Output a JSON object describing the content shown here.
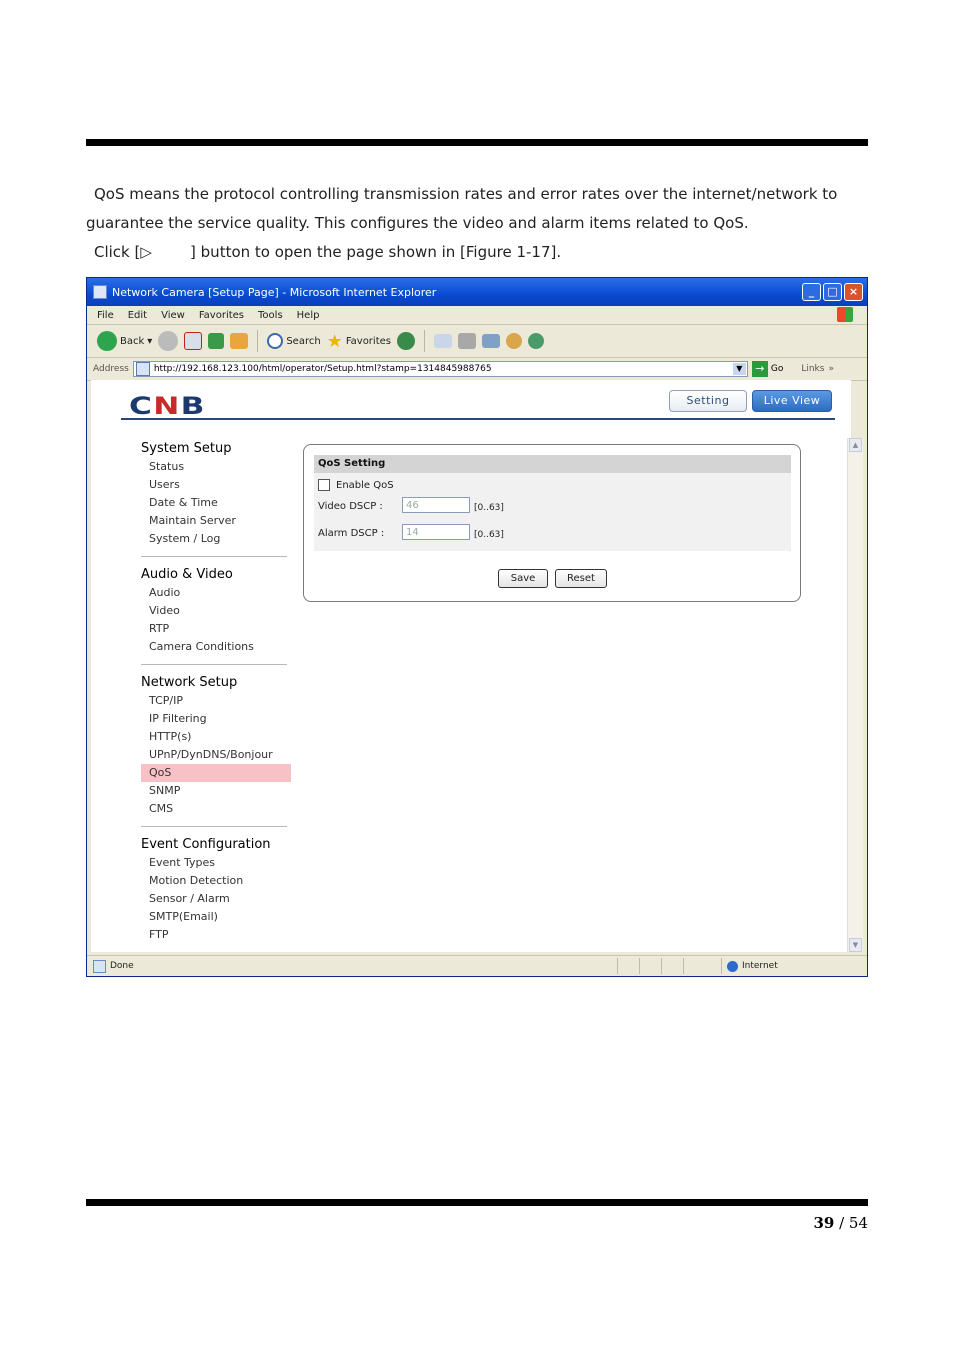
{
  "document": {
    "intro_line1": "QoS means the protocol controlling transmission rates and error rates over the internet/network to",
    "intro_line2": "guarantee the service quality. This configures the video and alarm items related to QoS.",
    "click_line": "Click [▷        ] button to open the page shown in [Figure 1-17].",
    "page_current": "39",
    "page_sep": " / ",
    "page_total": "54"
  },
  "browser": {
    "title": "Network Camera [Setup Page] - Microsoft Internet Explorer",
    "menu": [
      "File",
      "Edit",
      "View",
      "Favorites",
      "Tools",
      "Help"
    ],
    "toolbar": {
      "back": "Back",
      "search": "Search",
      "favorites": "Favorites"
    },
    "address_label": "Address",
    "url": "http://192.168.123.100/html/operator/Setup.html?stamp=1314845988765",
    "go": "Go",
    "links": "Links",
    "status_text": "Done",
    "zone": "Internet"
  },
  "app": {
    "logo": [
      "C",
      "N",
      "B"
    ],
    "setting_button": "Setting",
    "liveview_button": "Live View",
    "nav": [
      {
        "header": "System Setup",
        "items": [
          "Status",
          "Users",
          "Date & Time",
          "Maintain Server",
          "System / Log"
        ]
      },
      {
        "header": "Audio & Video",
        "items": [
          "Audio",
          "Video",
          "RTP",
          "Camera Conditions"
        ]
      },
      {
        "header": "Network Setup",
        "items": [
          "TCP/IP",
          "IP Filtering",
          "HTTP(s)",
          "UPnP/DynDNS/Bonjour",
          "QoS",
          "SNMP",
          "CMS"
        ]
      },
      {
        "header": "Event Configuration",
        "items": [
          "Event Types",
          "Motion Detection",
          "Sensor / Alarm",
          "SMTP(Email)",
          "FTP"
        ]
      }
    ],
    "active_item": "QoS",
    "qos": {
      "header": "QoS Setting",
      "enable_label": "Enable QoS",
      "enabled": false,
      "video_label": "Video DSCP :",
      "video_value": "46",
      "video_range": "[0..63]",
      "alarm_label": "Alarm DSCP :",
      "alarm_value": "14",
      "alarm_range": "[0..63]",
      "save": "Save",
      "reset": "Reset"
    }
  },
  "colors": {
    "titlebar": "#0a4bd0",
    "active_nav": "#f7c1c5",
    "brand_blue": "#1c3a6e",
    "brand_red": "#c62a2a"
  }
}
